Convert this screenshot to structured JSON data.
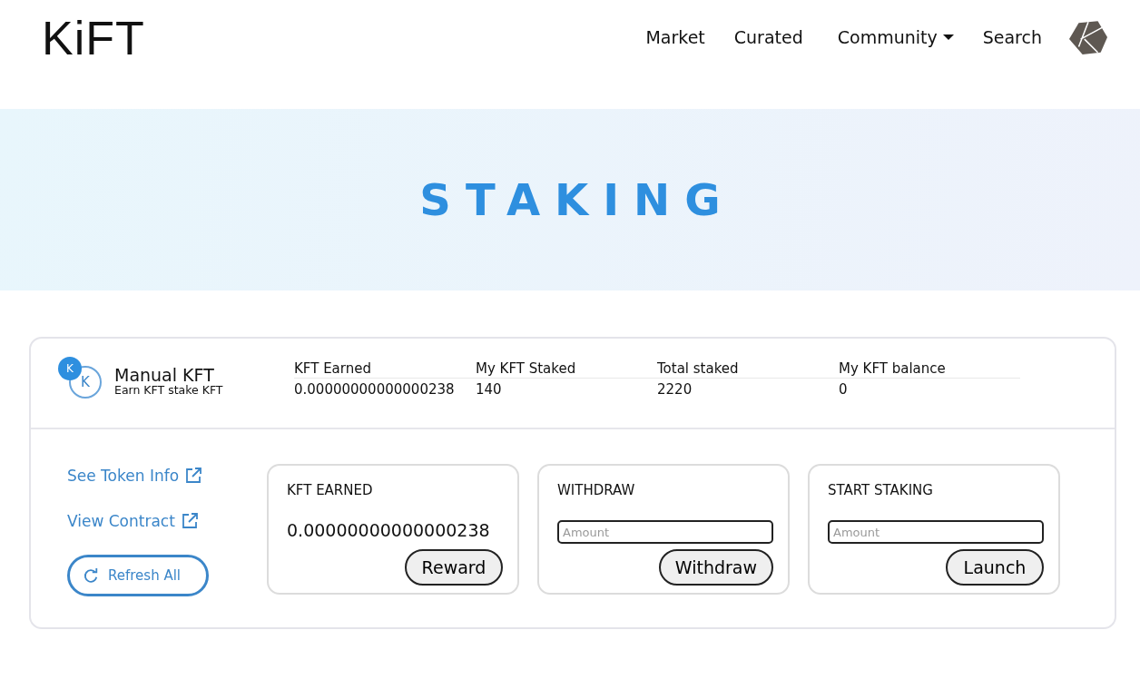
{
  "brand": "KiFT",
  "nav": [
    {
      "label": "Market",
      "dropdown": false
    },
    {
      "label": "Curated",
      "dropdown": false
    },
    {
      "label": "Community",
      "dropdown": true
    },
    {
      "label": "Search",
      "dropdown": false
    }
  ],
  "hero": {
    "title": "STAKING"
  },
  "pool": {
    "badge": "K",
    "token": "K",
    "name": "Manual KFT",
    "subtitle": "Earn KFT stake KFT",
    "stats": [
      {
        "label": "KFT Earned",
        "value": "0.00000000000000238"
      },
      {
        "label": "My KFT Staked",
        "value": "140"
      },
      {
        "label": "Total staked",
        "value": "2220"
      },
      {
        "label": "My KFT balance",
        "value": "0"
      }
    ]
  },
  "links": [
    "See Token Info",
    "View Contract"
  ],
  "refresh_button": "Refresh All",
  "panels": [
    {
      "kind": "value",
      "title": "KFT EARNED",
      "value": "0.00000000000000238",
      "button": "Reward"
    },
    {
      "kind": "input",
      "title": "WITHDRAW",
      "placeholder": "Amount",
      "button": "Withdraw"
    },
    {
      "kind": "input",
      "title": "START STAKING",
      "placeholder": "Amount",
      "button": "Launch"
    }
  ]
}
